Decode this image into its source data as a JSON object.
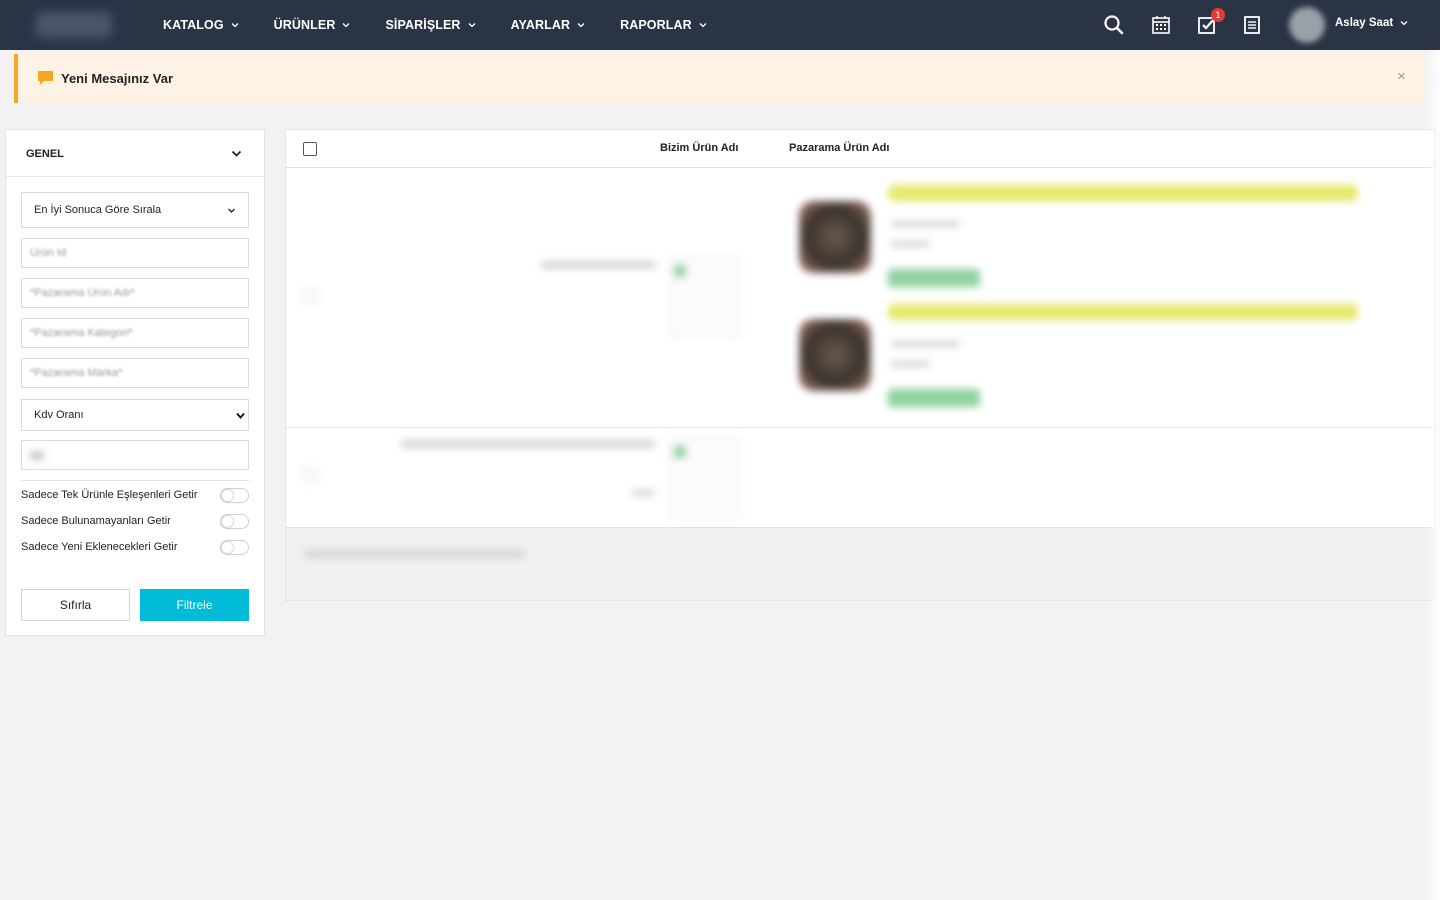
{
  "nav": {
    "items": [
      {
        "label": "KATALOG"
      },
      {
        "label": "ÜRÜNLER"
      },
      {
        "label": "SİPARİŞLER"
      },
      {
        "label": "AYARLAR"
      },
      {
        "label": "RAPORLAR"
      }
    ],
    "badge_count": "1",
    "user_name": "Aslay Saat",
    "icons": [
      "search-icon",
      "calendar-icon",
      "tasks-icon",
      "notes-icon"
    ]
  },
  "alert": {
    "text": "Yeni Mesajınız Var",
    "close": "×",
    "accent": "#f5a623",
    "background": "#fdf2e3"
  },
  "filter": {
    "title": "GENEL",
    "sort_selected": "En İyi Sonuca Göre Sırala",
    "product_id_placeholder": "Ürün Id",
    "pazarama_name_placeholder": "*Pazarama Ürün Adı*",
    "pazarama_category_placeholder": "*Pazarama Kategori*",
    "pazarama_brand_placeholder": "*Pazarama Marka*",
    "kdv_selected": "Kdv Oranı",
    "toggles": [
      {
        "label": "Sadece Tek Ürünle Eşleşenleri Getir",
        "on": false
      },
      {
        "label": "Sadece Bulunamayanları Getir",
        "on": false
      },
      {
        "label": "Sadece Yeni Eklenecekleri Getir",
        "on": false
      }
    ],
    "reset_label": "Sıfırla",
    "filter_label": "Filtrele",
    "filter_color": "#00bcd8"
  },
  "table": {
    "columns": [
      "Bizim Ürün Adı",
      "Pazarama Ürün Adı"
    ]
  },
  "colors": {
    "topbar": "#2b3445",
    "page_bg": "#f2f2f2"
  }
}
